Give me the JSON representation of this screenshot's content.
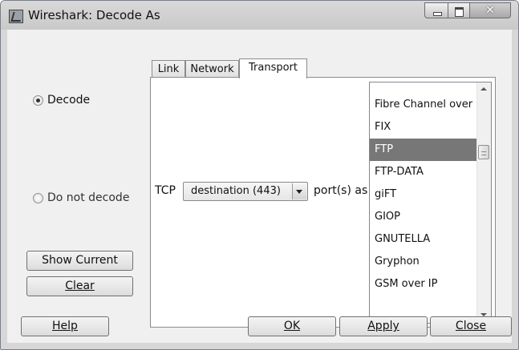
{
  "window": {
    "title": "Wireshark: Decode As",
    "controls": {
      "minimize": "minimize",
      "maximize": "maximize",
      "close": "close"
    }
  },
  "mode": {
    "options": [
      {
        "label": "Decode",
        "checked": true
      },
      {
        "label": "Do not decode",
        "checked": false
      }
    ]
  },
  "side_buttons": {
    "show_current": "Show Current",
    "clear": "Clear"
  },
  "tabs": [
    {
      "label": "Link",
      "active": false
    },
    {
      "label": "Network",
      "active": false
    },
    {
      "label": "Transport",
      "active": true
    }
  ],
  "transport": {
    "protocol_label": "TCP",
    "port_select": {
      "value": "destination (443)"
    },
    "ports_as_label": "port(s) as",
    "protocol_list": {
      "items": [
        "Fibre Channel over IP",
        "FIX",
        "FTP",
        "FTP-DATA",
        "giFT",
        "GIOP",
        "GNUTELLA",
        "Gryphon",
        "GSM over IP"
      ],
      "selected": "FTP"
    }
  },
  "footer": {
    "help": "Help",
    "ok": "OK",
    "apply": "Apply",
    "close": "Close"
  },
  "colors": {
    "selection": "#777777",
    "panel": "#ffffff",
    "dialog": "#f0f0f0"
  }
}
